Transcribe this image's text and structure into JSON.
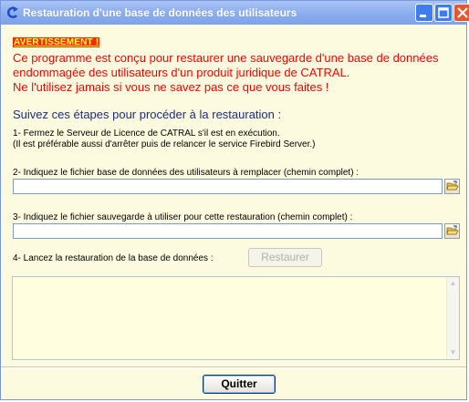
{
  "window": {
    "title": "Restauration d'une base de données des utilisateurs"
  },
  "warning": {
    "title": "AVERTISSEMENT !",
    "lines": [
      "Ce programme est conçu pour restaurer une sauvegarde d'une base de données",
      "endommagée des utilisateurs d'un produit juridique de CATRAL.",
      "Ne l'utilisez jamais si vous ne savez pas ce que vous faites !"
    ]
  },
  "steps": {
    "heading": "Suivez ces étapes pour procéder à la restauration :",
    "step1_line1": "1- Fermez le Serveur de Licence de CATRAL s'il est en exécution.",
    "step1_line2": "(Il est préférable aussi d'arrêter puis de relancer le service Firebird Server.)",
    "step2_label": "2- Indiquez le fichier base de données des utilisateurs à remplacer (chemin complet) :",
    "step2_value": "",
    "step3_label": "3- Indiquez le fichier sauvegarde à utiliser pour cette restauration (chemin complet) :",
    "step3_value": "",
    "step4_label": "4- Lancez la restauration de la base de données :",
    "restore_button": "Restaurer"
  },
  "log": {
    "text": ""
  },
  "footer": {
    "quit_button": "Quitter"
  },
  "colors": {
    "window_bg": "#fcfbdf",
    "warning_text": "#ff0000",
    "heading_text": "#1a2b8c",
    "log_bg": "#ffffe0"
  }
}
